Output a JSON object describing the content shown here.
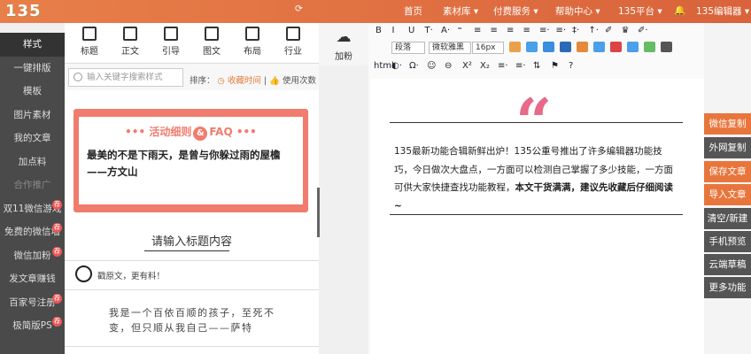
{
  "logo": "135",
  "topnav": {
    "home": "首页",
    "materials": "素材库 ▾",
    "paid": "付费服务 ▾",
    "help": "帮助中心 ▾",
    "platform": "135平台 ▾",
    "user": "135编辑器 ▾"
  },
  "sidebar": [
    {
      "label": "样式",
      "active": true
    },
    {
      "label": "一键排版"
    },
    {
      "label": "模板"
    },
    {
      "label": "图片素材"
    },
    {
      "label": "我的文章"
    },
    {
      "label": "加点料"
    },
    {
      "label": "合作推广",
      "faded": true
    },
    {
      "label": "双11微信游戏",
      "badge": "荐"
    },
    {
      "label": "免费的微信墙",
      "badge": "荐"
    },
    {
      "label": "微信加粉",
      "badge": "荐"
    },
    {
      "label": "发文章赚钱"
    },
    {
      "label": "百家号注册",
      "badge": "荐"
    },
    {
      "label": "极简版PS",
      "badge": "荐"
    }
  ],
  "categories": [
    "标题",
    "正文",
    "引导",
    "图文",
    "布局",
    "行业"
  ],
  "add_fans": "加粉",
  "search": {
    "placeholder": "输入关键字搜索样式"
  },
  "sort": {
    "label": "排序：",
    "by_time": "◷ 收藏时间",
    "by_use": "| 👍 使用次数"
  },
  "style_card": {
    "title_left": "••• 活动细则",
    "amp": "&",
    "title_right": "FAQ •••",
    "quote_line1": "最美的不是下雨天，是曾与你躲过雨的屋檐",
    "quote_line2": "——方文山"
  },
  "title_item": "请输入标题内容",
  "source_text": "戳原文，更有料！",
  "poem": "我是一个百依百顺的孩子，至死不变，但只顺从我自己——萨特",
  "toolbar": {
    "row1": [
      "B",
      "I",
      "U",
      "T·",
      "A·",
      "⁼",
      "≡",
      "≡",
      "≡",
      "≡",
      "≡·",
      "≡·",
      "‡·",
      "↑·",
      "✐",
      "♛",
      "✐·"
    ],
    "row2_boxes": [
      "段落",
      "微软雅黑",
      "16px"
    ],
    "row3": [
      "html",
      "◐·",
      "Ω·",
      "☺",
      "⊖",
      "X²",
      "X₂",
      "≡·",
      "≡·",
      "⇅",
      "⚑",
      "?"
    ]
  },
  "editor": {
    "quote_mark": "“",
    "text": "135最新功能合辑新鲜出炉！135公重号推出了许多编辑器功能技巧，今日做次大盘点，一方面可以检测自己掌握了多少技能，一方面可供大家快捷查找功能教程，",
    "bold_text": "本文干货满满，建议先收藏后仔细阅读~"
  },
  "right_buttons": [
    {
      "label": "微信复制",
      "style": "orange"
    },
    {
      "label": "外网复制",
      "style": "dark"
    },
    {
      "label": "保存文章",
      "style": "orange"
    },
    {
      "label": "导入文章",
      "style": "orange"
    },
    {
      "label": "清空/新建",
      "style": "dark"
    },
    {
      "label": "手机预览",
      "style": "dark"
    },
    {
      "label": "云端草稿",
      "style": "dark"
    },
    {
      "label": "更多功能",
      "style": "dark"
    }
  ],
  "colors": {
    "accent": "#e8763c",
    "sidebar": "#4a4a4a",
    "card": "#f07c6e",
    "quote": "#e8698a"
  }
}
